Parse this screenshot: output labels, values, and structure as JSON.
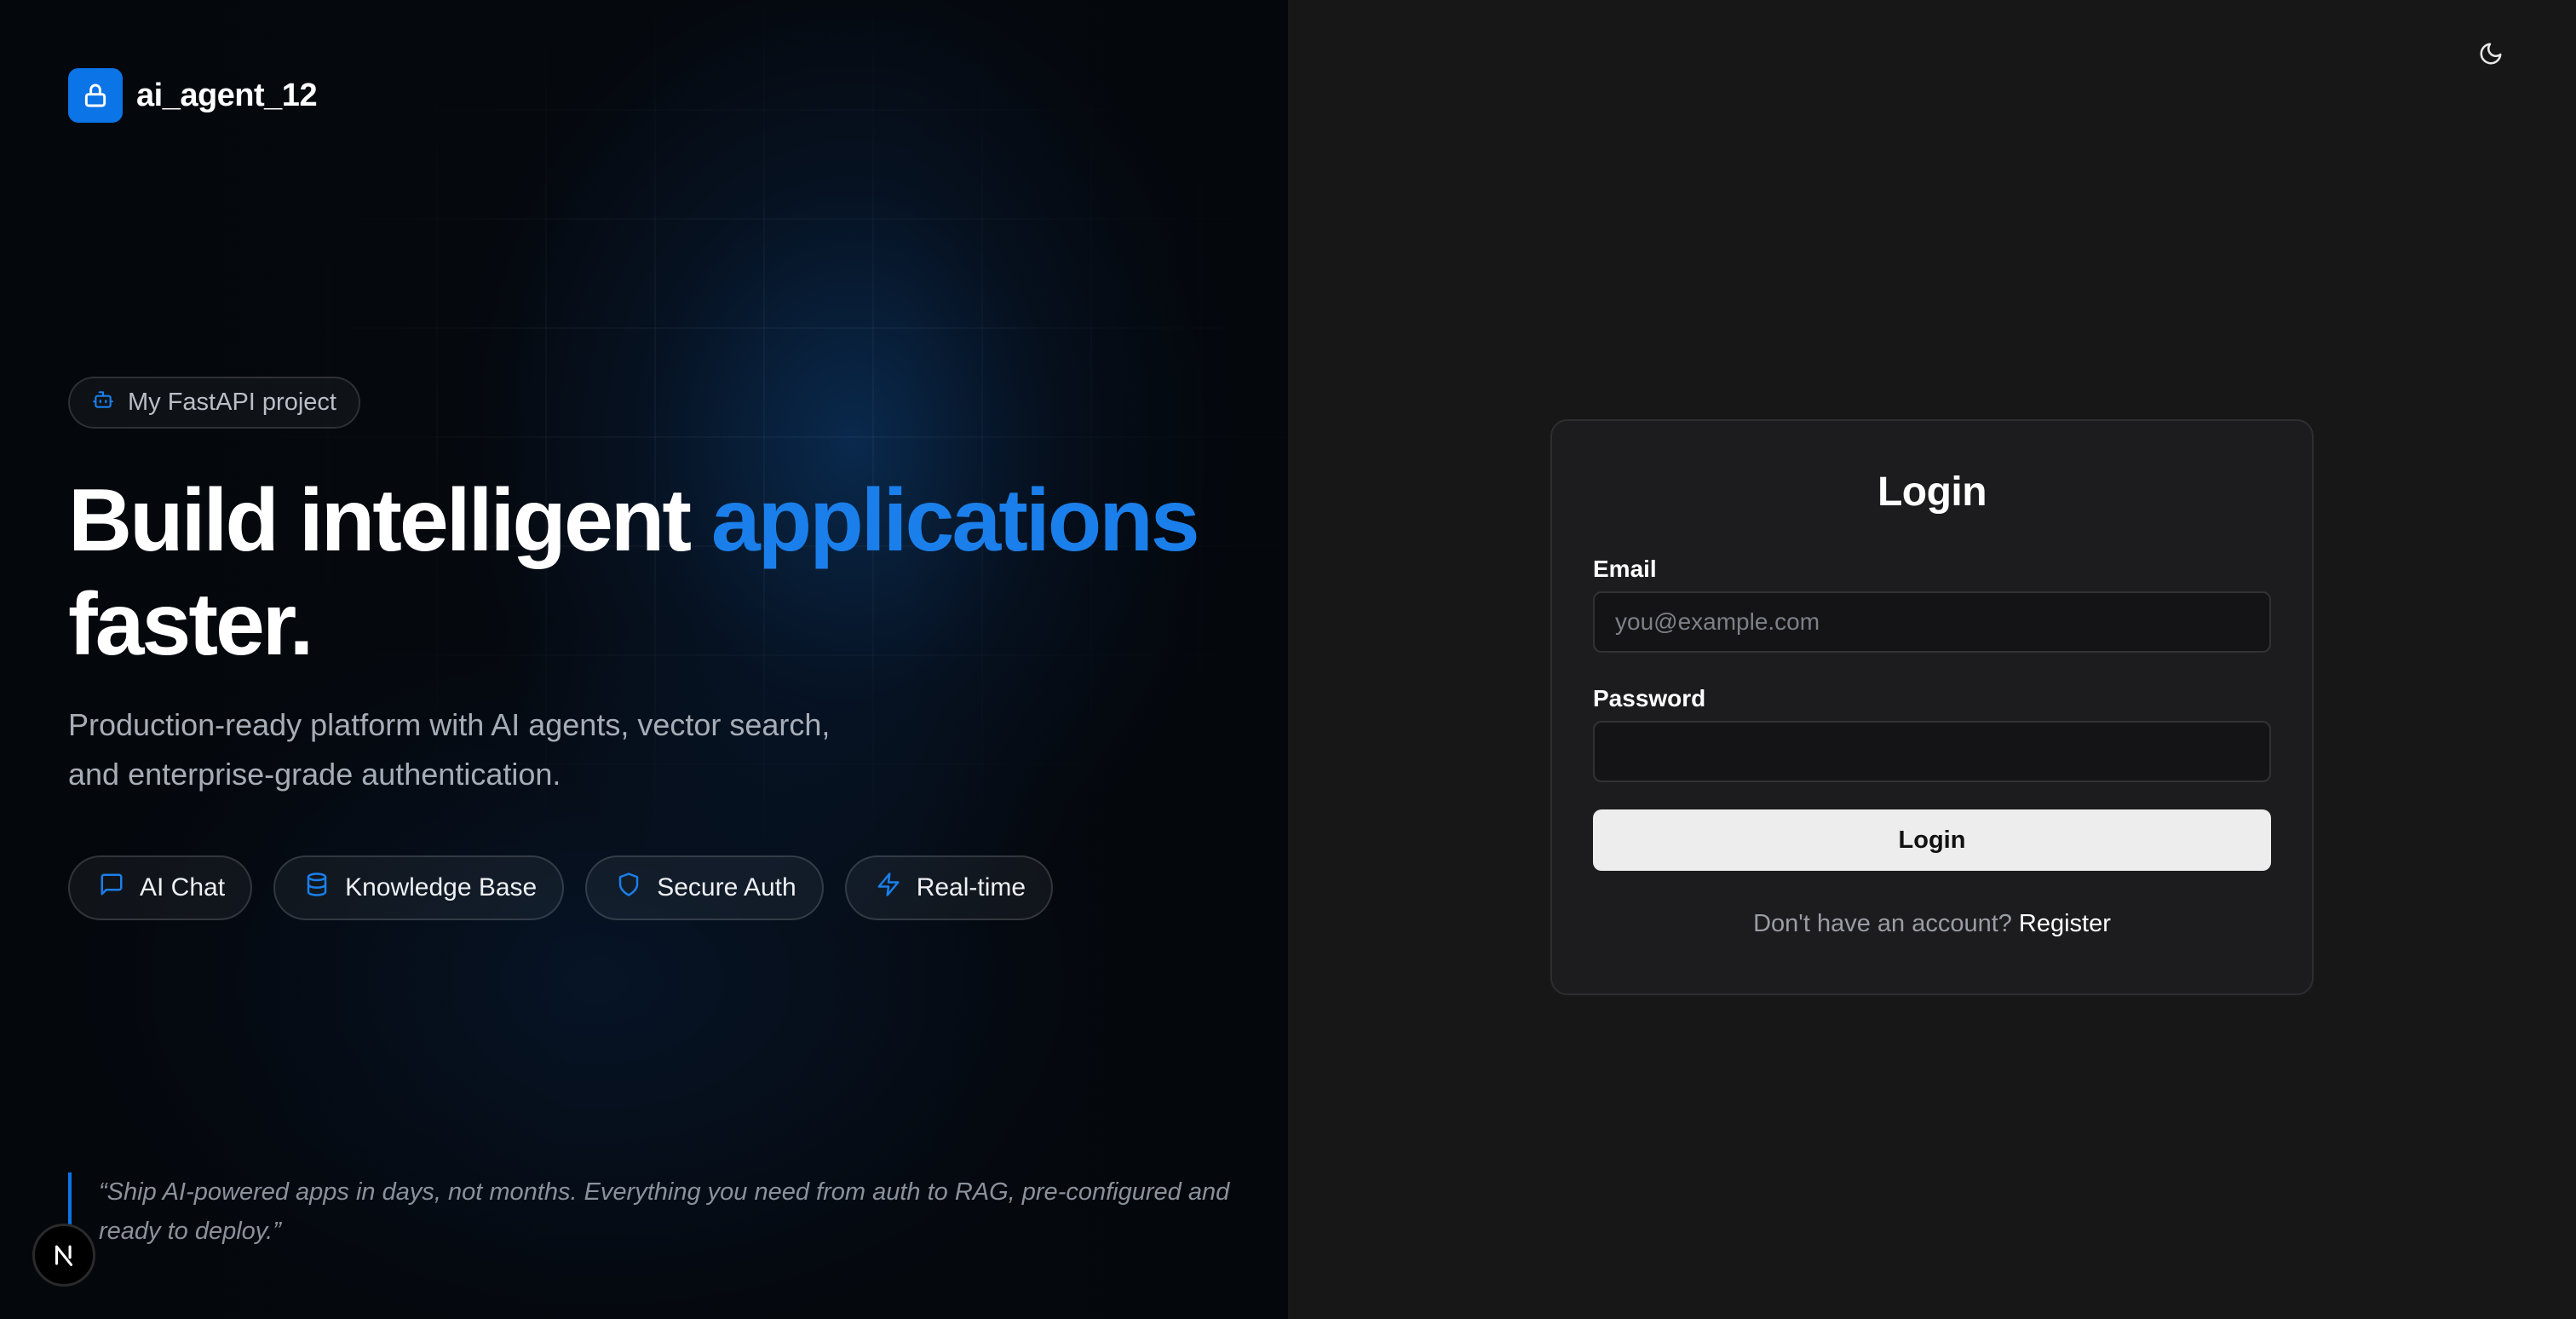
{
  "brand": {
    "name": "ai_agent_12",
    "icon": "lock-icon",
    "color": "#0b74e6"
  },
  "hero": {
    "tag": {
      "icon": "bot-icon",
      "label": "My FastAPI project"
    },
    "headline": {
      "part1": "Build intelligent ",
      "accent": "applications",
      "part2": "faster.",
      "accent_color": "#1a7fea"
    },
    "subtext": "Production-ready platform with AI agents, vector search, and enterprise-grade authentication.",
    "features": [
      {
        "icon": "message-square-icon",
        "label": "AI Chat"
      },
      {
        "icon": "database-icon",
        "label": "Knowledge Base"
      },
      {
        "icon": "shield-icon",
        "label": "Secure Auth"
      },
      {
        "icon": "zap-icon",
        "label": "Real-time"
      }
    ],
    "quote": "“Ship AI-powered apps in days, not months. Everything you need from auth to RAG, pre-configured and ready to deploy.”",
    "badge": {
      "icon": "nextjs-icon",
      "letter": "N"
    }
  },
  "header": {
    "theme_toggle_icon": "moon-icon"
  },
  "login": {
    "title": "Login",
    "email_label": "Email",
    "email_value": "",
    "email_placeholder": "you@example.com",
    "password_label": "Password",
    "password_value": "",
    "submit_label": "Login",
    "register_prompt": "Don't have an account?",
    "register_link": "Register"
  }
}
